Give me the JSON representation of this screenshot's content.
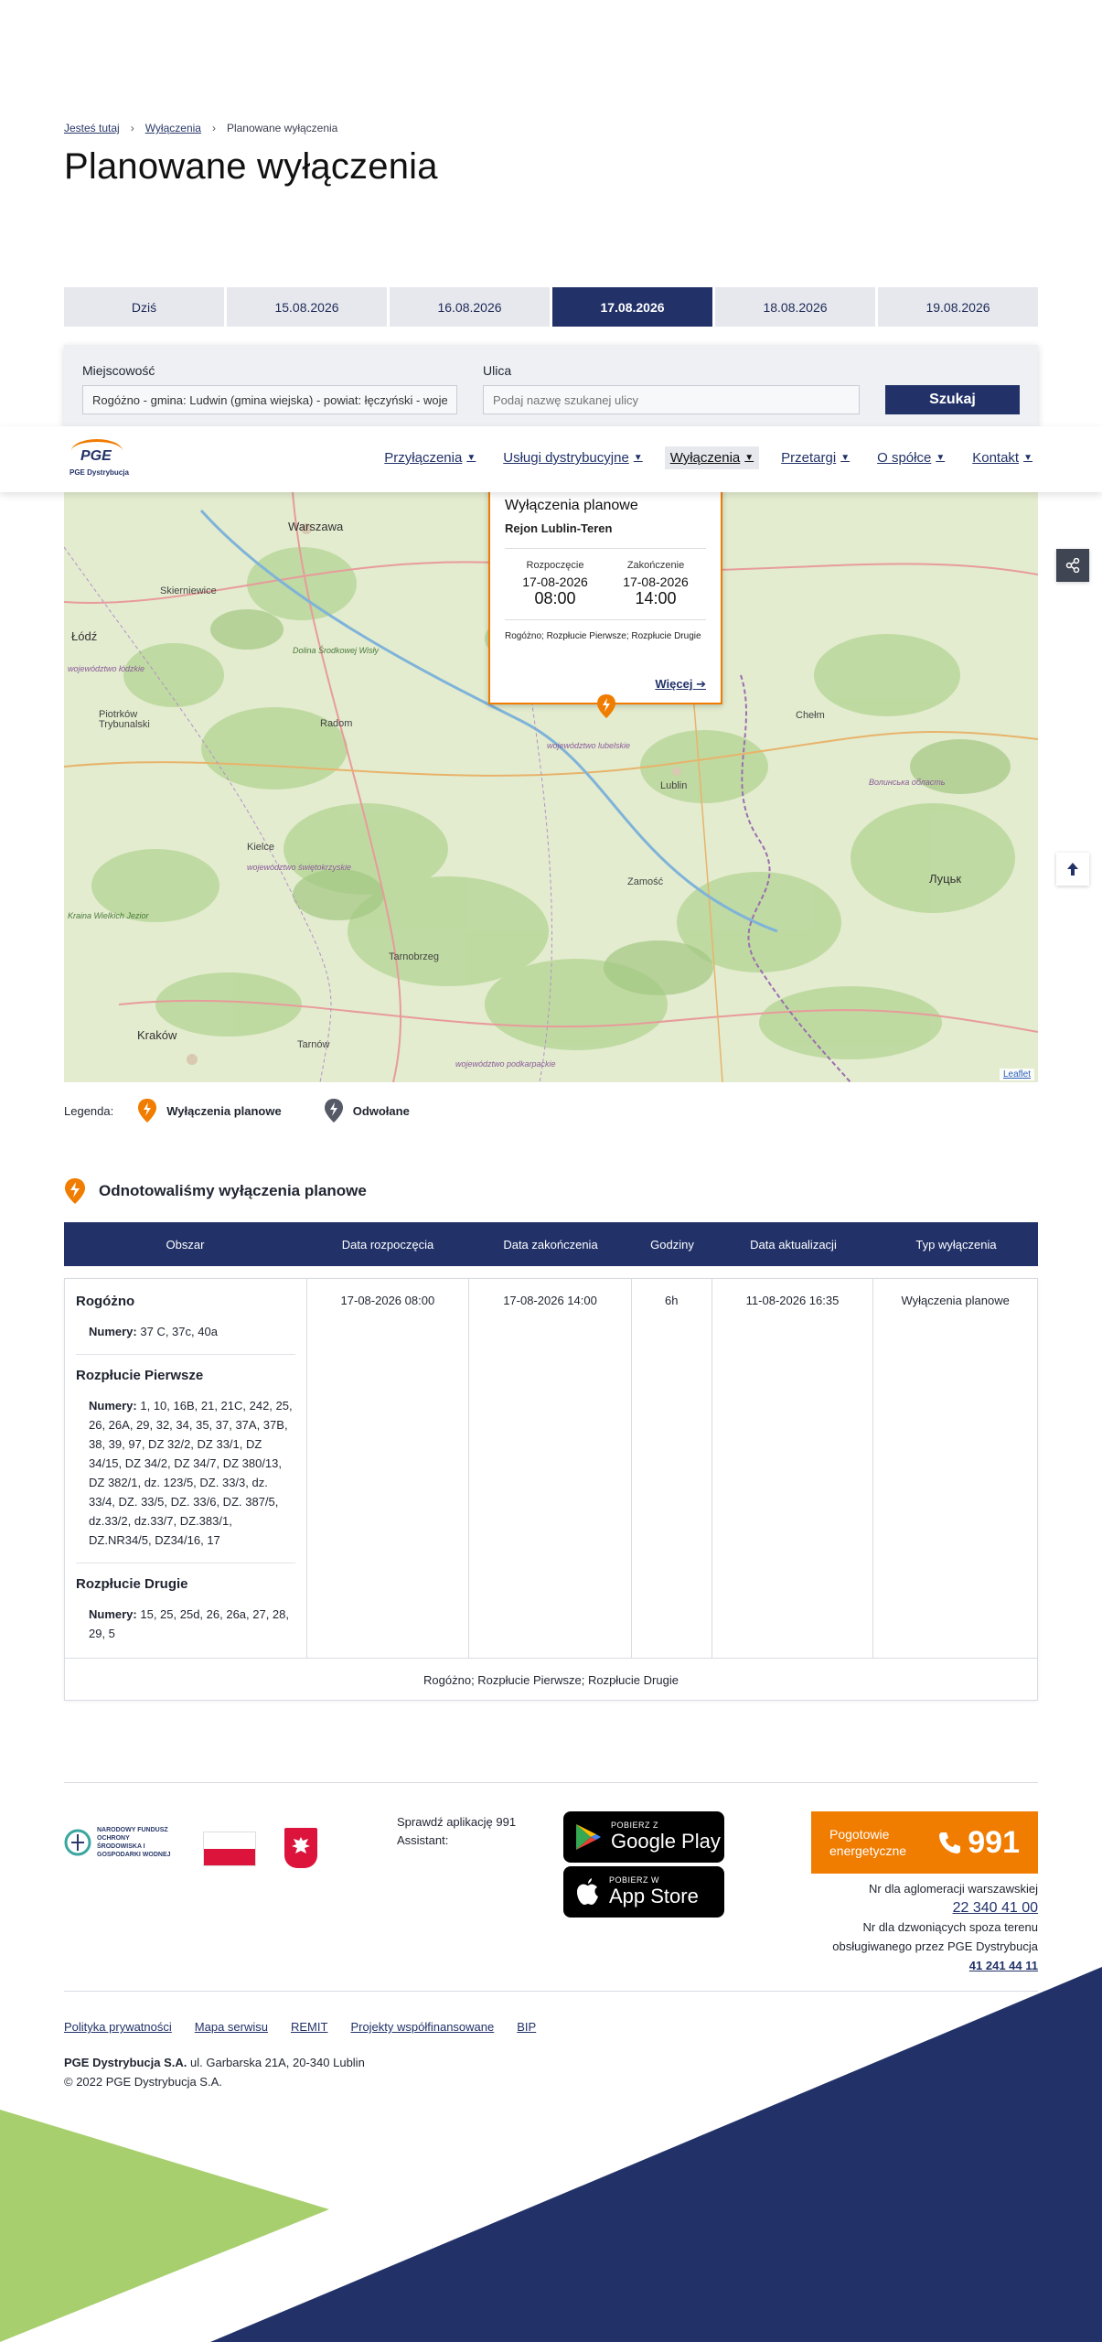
{
  "breadcrumb": {
    "label": "Jesteś tutaj",
    "items": [
      "Wyłączenia",
      "Planowane wyłączenia"
    ]
  },
  "page_title": "Planowane wyłączenia",
  "date_tabs": [
    "Dziś",
    "15.08.2026",
    "16.08.2026",
    "17.08.2026",
    "18.08.2026",
    "19.08.2026"
  ],
  "active_date_tab": "17.08.2026",
  "search": {
    "city_label": "Miejscowość",
    "city_value": "Rogóżno - gmina: Ludwin (gmina wiejska) - powiat: łęczyński - woje",
    "street_label": "Ulica",
    "street_placeholder": "Podaj nazwę szukanej ulicy",
    "button": "Szukaj"
  },
  "nav": {
    "logo_text": "PGE",
    "logo_sub": "PGE Dystrybucja",
    "items": [
      "Przyłączenia",
      "Usługi dystrybucyjne",
      "Wyłączenia",
      "Przetargi",
      "O spółce",
      "Kontakt"
    ],
    "active": "Wyłączenia"
  },
  "map": {
    "labels": {
      "warszawa": "Warszawa",
      "skierniewice": "Skierniewice",
      "lodz": "Łódź",
      "piotrkow": "Piotrków\nTrybunalski",
      "radom": "Radom",
      "kielce": "Kielce",
      "tarnobrzeg": "Tarnobrzeg",
      "krakow": "Kraków",
      "tarnow": "Tarnów",
      "lublin": "Lublin",
      "zamosc": "Zamość",
      "lutsk": "Луцьк",
      "woj_lubelskie": "województwo lubelskie",
      "woj_swietokrzyskie": "województwo świętokrzyskie",
      "woj_podkarpackie": "województwo podkarpackie",
      "woj_lodzkie": "województwo łódzkie",
      "wolynska": "Волинська область",
      "dolina": "Dolina Środkowej Wisły",
      "krainy": "Kraina Wielkich Jezior",
      "chelm": "Chełm"
    },
    "attribution": "Leaflet"
  },
  "popup": {
    "title": "Wyłączenia planowe",
    "subtitle": "Rejon Lublin-Teren",
    "start_label": "Rozpoczęcie",
    "start_date": "17-08-2026",
    "start_time": "08:00",
    "end_label": "Zakończenie",
    "end_date": "17-08-2026",
    "end_time": "14:00",
    "streets": "Rogóżno; Rozpłucie Pierwsze; Rozpłucie Drugie",
    "more": "Więcej"
  },
  "legend": {
    "label": "Legenda:",
    "planned": "Wyłączenia planowe",
    "cancelled": "Odwołane"
  },
  "found_heading": "Odnotowaliśmy wyłączenia planowe",
  "table": {
    "headers": [
      "Obszar",
      "Data rozpoczęcia",
      "Data zakończenia",
      "Godziny",
      "Data aktualizacji",
      "Typ wyłączenia"
    ],
    "numbers_label": "Numery:",
    "areas": [
      {
        "name": "Rogóżno",
        "numbers": "37 C, 37c, 40a"
      },
      {
        "name": "Rozpłucie Pierwsze",
        "numbers": "1, 10, 16B, 21, 21C, 242, 25, 26, 26A, 29, 32, 34, 35, 37, 37A, 37B, 38, 39, 97, DZ 32/2, DZ 33/1, DZ 34/15, DZ 34/2, DZ 34/7, DZ 380/13, DZ 382/1, dz. 123/5, DZ. 33/3, dz. 33/4, DZ. 33/5, DZ. 33/6, DZ. 387/5, dz.33/2, dz.33/7, DZ.383/1, DZ.NR34/5, DZ34/16, 17"
      },
      {
        "name": "Rozpłucie Drugie",
        "numbers": "15, 25, 25d, 26, 26a, 27, 28, 29, 5"
      }
    ],
    "start": "17-08-2026 08:00",
    "end": "17-08-2026 14:00",
    "hours": "6h",
    "updated": "11-08-2026 16:35",
    "type": "Wyłączenia planowe",
    "footer": "Rogóżno; Rozpłucie Pierwsze; Rozpłucie Drugie"
  },
  "footer": {
    "nfosigw": "NARODOWY FUNDUSZ OCHRONY ŚRODOWISKA I GOSPODARKI WODNEJ",
    "app_check": "Sprawdź aplikację 991 Assistant:",
    "google_small": "POBIERZ Z",
    "google_big": "Google Play",
    "apple_small": "POBIERZ W",
    "apple_big": "App Store",
    "emergency_label": "Pogotowie energetyczne",
    "emergency_number": "991",
    "warsaw_label": "Nr dla aglomeracji warszawskiej",
    "warsaw_number": "22 340 41 00",
    "outside_label": "Nr dla dzwoniących spoza terenu obsługiwanego przez PGE Dystrybucja",
    "outside_number": "41 241 44 11",
    "links": [
      "Polityka prywatności",
      "Mapa serwisu",
      "REMIT",
      "Projekty współfinansowane",
      "BIP"
    ],
    "company": "PGE Dystrybucja S.A.",
    "address": "ul. Garbarska 21A, 20-340 Lublin",
    "copyright": "© 2022 PGE Dystrybucja S.A."
  },
  "colors": {
    "navy": "#223268",
    "orange": "#f07c00",
    "green": "#a8cf6e",
    "gray": "#3f4552"
  }
}
